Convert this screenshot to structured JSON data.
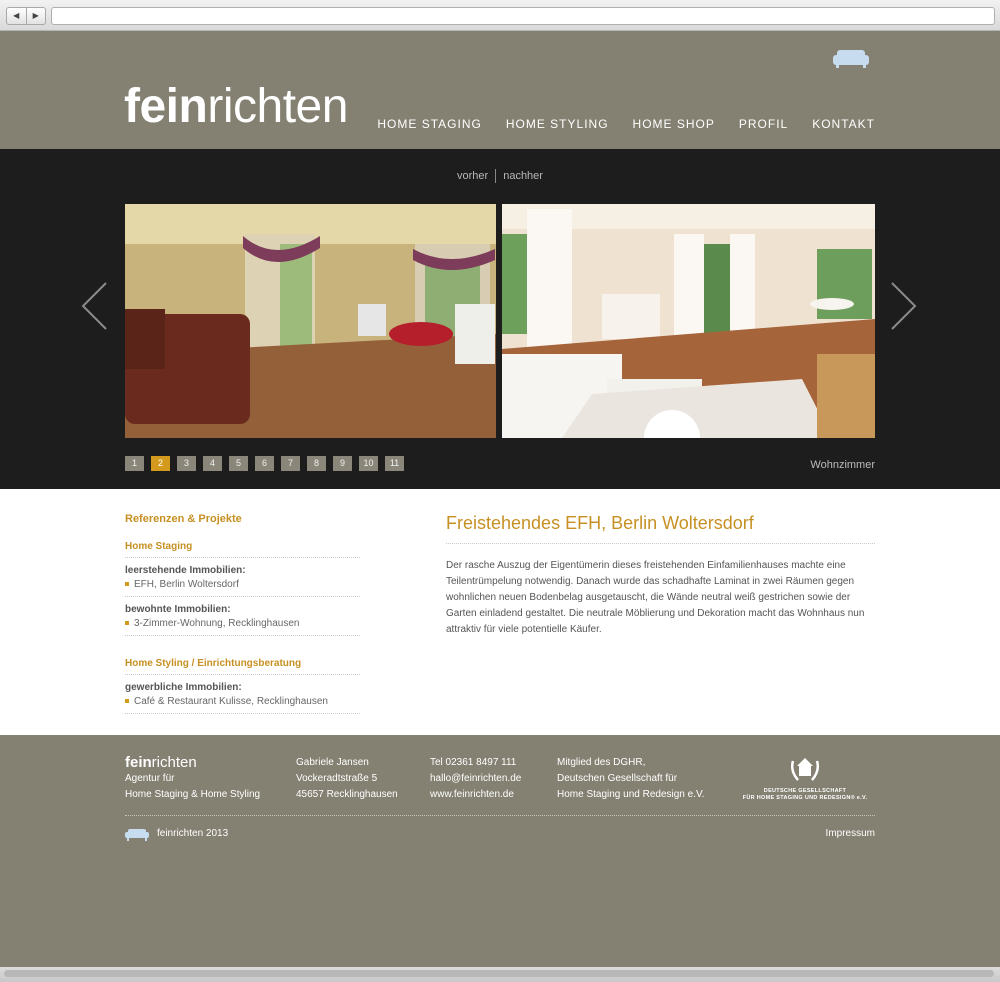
{
  "browser": {
    "back": "◀",
    "forward": "▶"
  },
  "logo": {
    "bold": "fein",
    "light": "richten"
  },
  "nav": [
    "HOME STAGING",
    "HOME STYLING",
    "HOME SHOP",
    "PROFIL",
    "KONTAKT"
  ],
  "slider": {
    "toggle_before": "vorher",
    "toggle_after": "nachher",
    "pages": [
      "1",
      "2",
      "3",
      "4",
      "5",
      "6",
      "7",
      "8",
      "9",
      "10",
      "11"
    ],
    "active_page": "2",
    "caption": "Wohnzimmer"
  },
  "sidebar": {
    "title": "Referenzen & Projekte",
    "sections": [
      {
        "heading": "Home Staging",
        "groups": [
          {
            "label": "leerstehende Immobilien:",
            "items": [
              "EFH, Berlin Woltersdorf"
            ]
          },
          {
            "label": "bewohnte Immobilien:",
            "items": [
              "3-Zimmer-Wohnung, Recklinghausen"
            ]
          }
        ]
      },
      {
        "heading": "Home Styling / Einrichtungsberatung",
        "groups": [
          {
            "label": "gewerbliche Immobilien:",
            "items": [
              "Café & Restaurant Kulisse, Recklinghausen"
            ]
          }
        ]
      }
    ]
  },
  "article": {
    "title": "Freistehendes EFH, Berlin Woltersdorf",
    "text": "Der rasche Auszug der Eigentümerin dieses freistehenden Einfamilienhauses machte eine Teilentrümpelung notwendig. Danach wurde das schadhafte Laminat in zwei Räumen gegen wohnlichen neuen Bodenbelag ausgetauscht, die Wände neutral weiß gestrichen sowie der Garten einladend gestaltet. Die neutrale Möblierung und Dekoration macht das Wohnhaus nun attraktiv für viele potentielle Käufer."
  },
  "footer": {
    "logo_bold": "fein",
    "logo_light": "richten",
    "agency": [
      "Agentur für",
      "Home Staging & Home Styling"
    ],
    "address": [
      "Gabriele Jansen",
      "Vockeradtstraße 5",
      "45657 Recklinghausen"
    ],
    "contact": [
      "Tel 02361 8497 111",
      "hallo@feinrichten.de",
      "www.feinrichten.de"
    ],
    "membership": [
      "Mitglied des DGHR,",
      "Deutschen Gesellschaft für",
      "Home Staging und Redesign e.V."
    ],
    "dghr_logo": [
      "DEUTSCHE GESELLSCHAFT",
      "FÜR HOME STAGING UND REDESIGN® e.V."
    ],
    "copyright": "feinrichten 2013",
    "impressum": "Impressum"
  },
  "colors": {
    "accent": "#c79023",
    "header_bg": "#848072",
    "slider_bg": "#1d1d1d"
  }
}
